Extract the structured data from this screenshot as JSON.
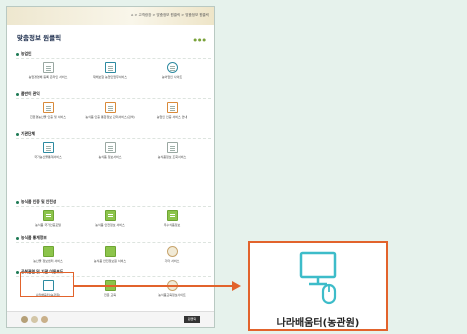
{
  "page": {
    "title": "맞춤정보 원클릭",
    "breadcrumb": "⌂ > 고객광장 > 맞춤정보 원클릭 > 맞춤정보 원클릭"
  },
  "sections": [
    {
      "title": "농업인",
      "items": [
        {
          "label": "농업경영체 등록 온라인 서비스",
          "icon": "document-icon"
        },
        {
          "label": "재해보험 농업인업무서비스",
          "icon": "report-icon"
        },
        {
          "label": "농어업인 사이트",
          "icon": "bottle-icon"
        }
      ]
    },
    {
      "title": "품반이 관익",
      "items": [
        {
          "label": "친환경농산물 인증 및 서비스",
          "icon": "certificate-icon"
        },
        {
          "label": "농식품 인증 통합정보 관리서비스(검색)",
          "icon": "checklist-icon"
        },
        {
          "label": "농업인 인증 서비스 안내",
          "icon": "form-icon"
        }
      ]
    },
    {
      "title": "기관단체",
      "items": [
        {
          "label": "국가농산물통계서비스",
          "icon": "stamp-icon"
        },
        {
          "label": "농식품 정보서비스",
          "icon": "ledger-icon"
        },
        {
          "label": "농식품정보 조회서비스",
          "icon": "list-icon"
        }
      ]
    },
    {
      "title": "농식품 인증 및 안전성",
      "items": [
        {
          "label": "농식품 국가인증포털",
          "icon": "chat-icon"
        },
        {
          "label": "농식품 안전정보 서비스",
          "icon": "message-icon"
        },
        {
          "label": "우수식품정보",
          "icon": "bubble-icon"
        }
      ]
    },
    {
      "title": "농식품 통계정보",
      "items": [
        {
          "label": "농산물 정보센터 서비스",
          "icon": "chart-icon"
        },
        {
          "label": "농식품 안전정보원 서비스",
          "icon": "chart-icon"
        },
        {
          "label": "기타 서비스",
          "icon": "medal-icon"
        }
      ]
    },
    {
      "title": "공취관련 및 기관 이동포도",
      "items": [
        {
          "label": "나라배움터(농관원)",
          "icon": "monitor-mouse-icon"
        },
        {
          "label": "전문 교육",
          "icon": "video-icon"
        },
        {
          "label": "농식품교육정보사이트",
          "icon": "emblem-icon"
        }
      ]
    }
  ],
  "footer": {
    "button": "원클릭"
  },
  "zoom": {
    "label": "나라배움터(농관원)",
    "icon": "monitor-mouse-icon"
  },
  "colors": {
    "accent": "#e2632c",
    "section_bullet": "#1f7a55",
    "monitor": "#3dbcc9"
  }
}
